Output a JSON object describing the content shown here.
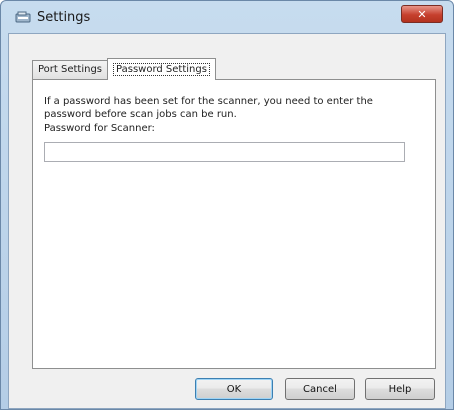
{
  "window": {
    "title": "Settings",
    "close_glyph": "✕"
  },
  "tabs": [
    {
      "label": "Port Settings",
      "active": false
    },
    {
      "label": "Password Settings",
      "active": true
    }
  ],
  "panel": {
    "description": "If a password has been set for the scanner, you need to enter the password before scan jobs can be run.",
    "password_label": "Password for Scanner:",
    "password_value": "",
    "password_placeholder": ""
  },
  "buttons": {
    "ok": "OK",
    "cancel": "Cancel",
    "help": "Help"
  },
  "colors": {
    "titlebar": "#c7dcef",
    "close": "#c6402e",
    "client": "#f0f0f0"
  }
}
